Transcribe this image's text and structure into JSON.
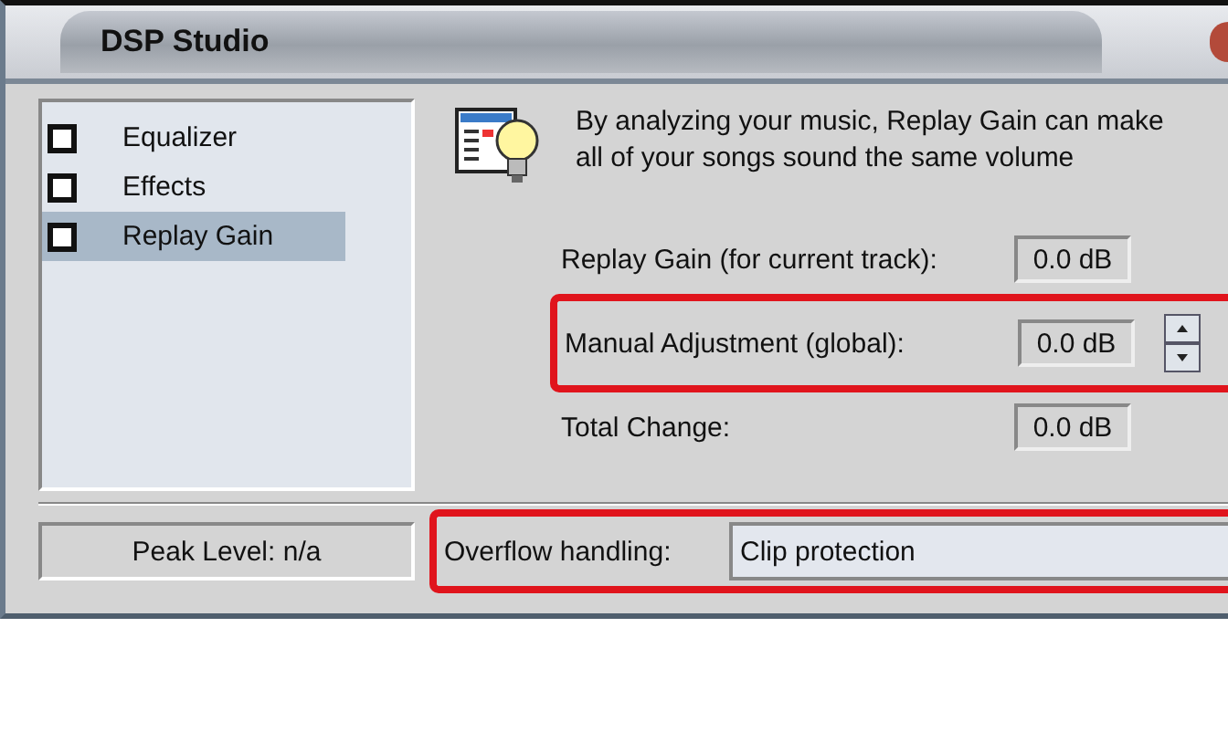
{
  "window": {
    "title": "DSP Studio"
  },
  "modules": [
    {
      "label": "Equalizer",
      "checked": false,
      "selected": false
    },
    {
      "label": "Effects",
      "checked": false,
      "selected": false
    },
    {
      "label": "Replay Gain",
      "checked": false,
      "selected": true
    }
  ],
  "description": "By analyzing your music, Replay Gain can make all of your songs sound the same volume",
  "fields": [
    {
      "kind": "readout",
      "label": "Replay Gain (for current track):",
      "value": "0.0 dB",
      "highlighted": false
    },
    {
      "kind": "spinner",
      "label": "Manual Adjustment (global):",
      "value": "0.0 dB",
      "highlighted": true
    },
    {
      "kind": "readout",
      "label": "Total Change:",
      "value": "0.0 dB",
      "highlighted": false
    }
  ],
  "status": "Peak Level: n/a",
  "overflow": {
    "label": "Overflow handling:",
    "value": "Clip protection",
    "highlighted": true
  }
}
